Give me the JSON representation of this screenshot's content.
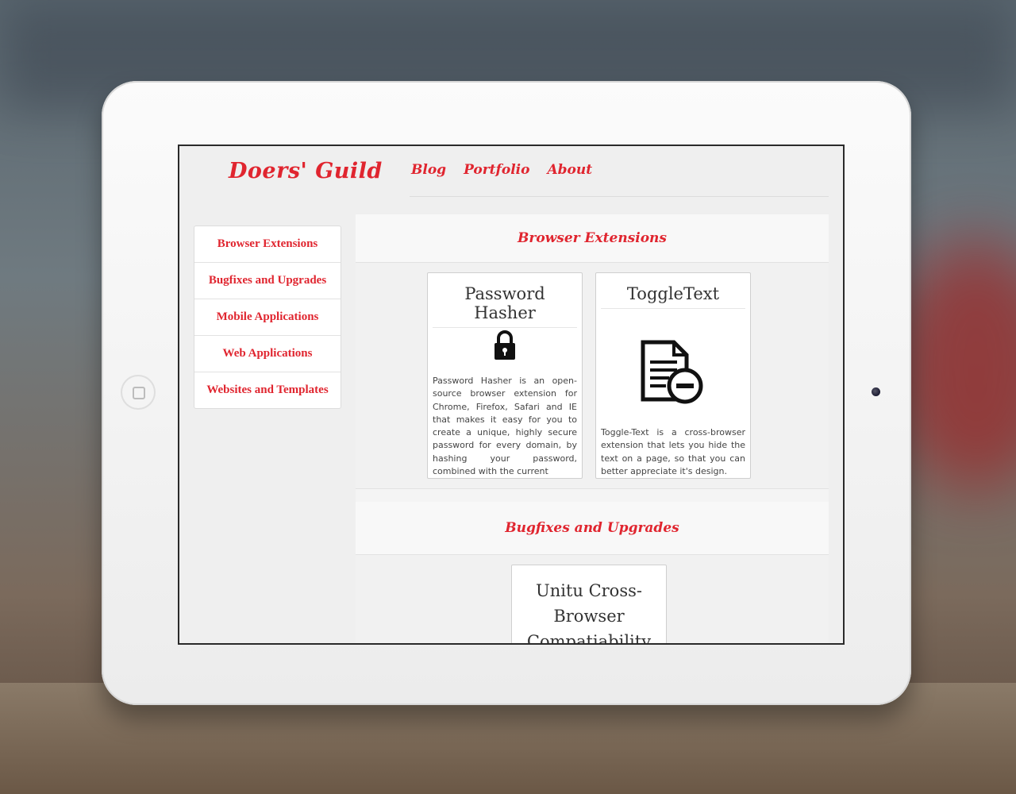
{
  "site": {
    "brand": "Doers' Guild",
    "nav": [
      "Blog",
      "Portfolio",
      "About"
    ]
  },
  "sidebar": {
    "items": [
      "Browser Extensions",
      "Bugfixes and Upgrades",
      "Mobile Applications",
      "Web Applications",
      "Websites and Templates"
    ]
  },
  "sections": [
    {
      "title": "Browser Extensions",
      "cards": [
        {
          "title": "Password Hasher",
          "icon": "lock-icon",
          "description": "Password Hasher is an open-source browser extension for Chrome, Firefox, Safari and IE that makes it easy for you to create a unique, highly secure password for every domain, by hashing your password, combined with the current"
        },
        {
          "title": "ToggleText",
          "icon": "document-remove-icon",
          "description": "Toggle-Text is a cross-browser extension that lets you hide the text on a page, so that you can better appreciate it's design."
        }
      ]
    },
    {
      "title": "Bugfixes and Upgrades",
      "cards": [
        {
          "title": "Unitu Cross-Browser Compatiability"
        }
      ]
    }
  ]
}
